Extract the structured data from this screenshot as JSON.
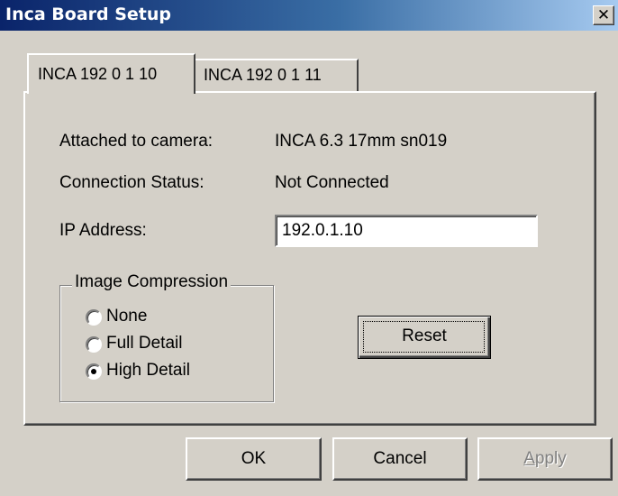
{
  "window": {
    "title": "Inca Board Setup",
    "close_glyph": "✕",
    "close_icon": "close-icon"
  },
  "tabs": [
    {
      "label": "INCA 192 0 1 10",
      "active": true
    },
    {
      "label": "INCA 192 0 1 11",
      "active": false
    }
  ],
  "fields": {
    "camera_label": "Attached to camera:",
    "camera_value": "INCA 6.3 17mm sn019",
    "status_label": "Connection Status:",
    "status_value": "Not Connected",
    "ip_label": "IP Address:",
    "ip_value": "192.0.1.10"
  },
  "compression": {
    "title": "Image Compression",
    "options": [
      {
        "label": "None",
        "checked": false
      },
      {
        "label": "Full Detail",
        "checked": false
      },
      {
        "label": "High Detail",
        "checked": true
      }
    ]
  },
  "buttons": {
    "reset": "Reset",
    "ok": "OK",
    "cancel": "Cancel",
    "apply": "Apply",
    "apply_enabled": false
  },
  "colors": {
    "titlebar_start": "#0a246a",
    "titlebar_end": "#a6caf0",
    "face": "#d4d0c8",
    "disabled_text": "#808080"
  }
}
